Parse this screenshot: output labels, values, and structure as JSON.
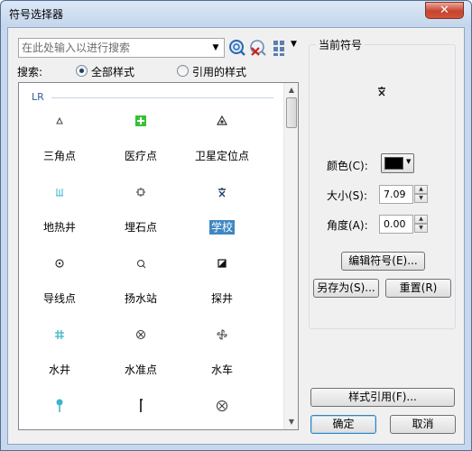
{
  "window": {
    "title": "符号选择器",
    "close_glyph": "✕"
  },
  "search": {
    "placeholder": "在此处输入以进行搜索",
    "scope_label": "搜索:",
    "option_all": "全部样式",
    "option_ref": "引用的样式",
    "selected": "全部样式"
  },
  "toolbar": {
    "icons": [
      "search-icon",
      "clear-search-icon",
      "view-options-icon"
    ]
  },
  "library": {
    "group": "LR",
    "symbols": [
      {
        "label": "三角点",
        "icon": "triangle-point-icon"
      },
      {
        "label": "医疗点",
        "icon": "medical-point-icon"
      },
      {
        "label": "卫星定位点",
        "icon": "gps-point-icon"
      },
      {
        "label": "地热井",
        "icon": "geothermal-well-icon"
      },
      {
        "label": "埋石点",
        "icon": "buried-stone-point-icon"
      },
      {
        "label": "学校",
        "icon": "school-icon",
        "selected": true
      },
      {
        "label": "导线点",
        "icon": "traverse-point-icon"
      },
      {
        "label": "扬水站",
        "icon": "pumping-station-icon"
      },
      {
        "label": "探井",
        "icon": "exploration-well-icon"
      },
      {
        "label": "水井",
        "icon": "water-well-icon"
      },
      {
        "label": "水准点",
        "icon": "benchmark-icon"
      },
      {
        "label": "水车",
        "icon": "waterwheel-icon"
      },
      {
        "label": "",
        "icon": "lamp-icon"
      },
      {
        "label": "",
        "icon": "pole-icon"
      },
      {
        "label": "",
        "icon": "cross-circle-icon"
      }
    ]
  },
  "current": {
    "title": "当前符号",
    "color_label": "颜色(C):",
    "color_value": "#000000",
    "size_label": "大小(S):",
    "size_value": "7.09",
    "angle_label": "角度(A):",
    "angle_value": "0.00",
    "edit_button": "编辑符号(E)...",
    "saveas_button": "另存为(S)...",
    "reset_button": "重置(R)"
  },
  "footer": {
    "style_ref_button": "样式引用(F)...",
    "ok_button": "确定",
    "cancel_button": "取消"
  },
  "colors": {
    "accent": "#3e87c2",
    "group_label": "#2f5f9e",
    "medical": "#35c235",
    "well": "#39b4c8"
  }
}
